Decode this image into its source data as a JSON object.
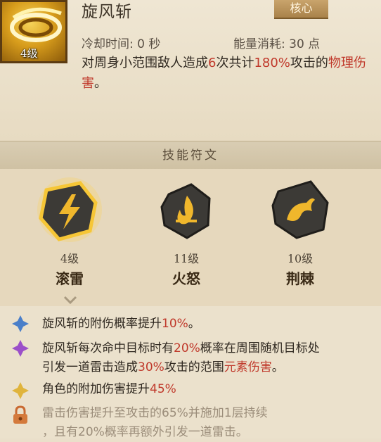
{
  "skill": {
    "name": "旋风斩",
    "level_label": "4级",
    "badge": "核心",
    "cooldown": "冷却时间: 0 秒",
    "energy": "能量消耗: 30 点",
    "desc_parts": {
      "p1": "对周身小范围敌人造成",
      "p2": "6",
      "p3": "次共计",
      "p4": "180%",
      "p5": "攻击的",
      "p6": "物理伤害",
      "p7": "。"
    }
  },
  "runes": {
    "title": "技能符文",
    "items": [
      {
        "level": "4级",
        "name": "滚雷",
        "icon": "lightning-rune-icon"
      },
      {
        "level": "11级",
        "name": "火怒",
        "icon": "fire-rune-icon"
      },
      {
        "level": "10级",
        "name": "荆棘",
        "icon": "thorn-rune-icon"
      }
    ]
  },
  "effects": {
    "e1": {
      "a": "旋风斩的附伤概率提升",
      "b": "10%",
      "c": "。"
    },
    "e2": {
      "a": "旋风斩每次命中目标时有",
      "b": "20%",
      "c": "概率在周围随机目标处",
      "d": "引发一道雷击造成",
      "e": "30%",
      "f": "攻击的范围",
      "g": "元素伤害",
      "h": "。"
    },
    "e3": {
      "a": "角色的附加伤害提升",
      "b": "45%"
    },
    "e4": {
      "a": "雷击伤害提升至攻击的65%并施加1层持续",
      "b": "，且有20%概率再额外引发一道雷击。"
    }
  },
  "colors": {
    "highlight": "#c0392b",
    "gold": "#e9b52a",
    "rune_dark": "#3c3a36"
  }
}
